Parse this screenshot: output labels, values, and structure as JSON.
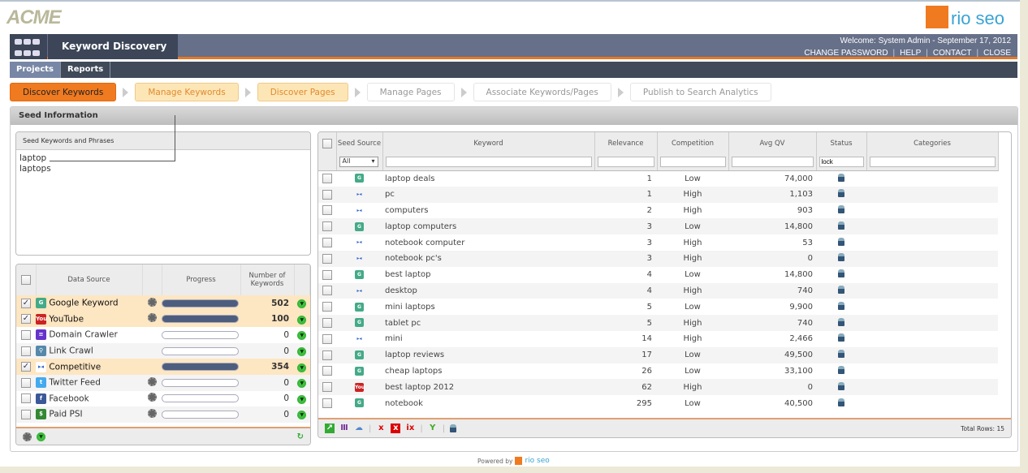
{
  "brand": {
    "client_logo": "ACME",
    "vendor_logo": "rio seo"
  },
  "header": {
    "module_title": "Keyword Discovery",
    "welcome": "Welcome: System Admin  -   September 17, 2012",
    "links": [
      "CHANGE PASSWORD",
      "HELP",
      "CONTACT",
      "CLOSE"
    ]
  },
  "subnav": [
    "Projects",
    "Reports"
  ],
  "steps": [
    {
      "label": "Discover Keywords",
      "state": "current"
    },
    {
      "label": "Manage Keywords",
      "state": "done"
    },
    {
      "label": "Discover Pages",
      "state": "done"
    },
    {
      "label": "Manage Pages",
      "state": "disabled"
    },
    {
      "label": "Associate Keywords/Pages",
      "state": "disabled"
    },
    {
      "label": "Publish to Search Analytics",
      "state": "disabled"
    }
  ],
  "panel": {
    "title": "Seed Information"
  },
  "seed": {
    "title": "Seed Keywords and Phrases",
    "lines": [
      "laptop",
      "laptops"
    ]
  },
  "sources": {
    "headers": [
      "Data Source",
      "Progress",
      "Number of Keywords"
    ],
    "rows": [
      {
        "name": "Google Keyword",
        "checked": true,
        "icon": "google-icon",
        "gear": true,
        "progress": 100,
        "count": "502"
      },
      {
        "name": "YouTube",
        "checked": true,
        "icon": "youtube-icon",
        "gear": true,
        "progress": 100,
        "count": "100"
      },
      {
        "name": "Domain Crawler",
        "checked": false,
        "icon": "domain-crawler-icon",
        "gear": false,
        "progress": 0,
        "count": "0"
      },
      {
        "name": "Link Crawl",
        "checked": false,
        "icon": "link-crawl-icon",
        "gear": false,
        "progress": 0,
        "count": "0"
      },
      {
        "name": "Competitive",
        "checked": true,
        "icon": "competitive-icon",
        "gear": false,
        "progress": 100,
        "count": "354"
      },
      {
        "name": "Twitter Feed",
        "checked": false,
        "icon": "twitter-icon",
        "gear": true,
        "progress": 0,
        "count": "0"
      },
      {
        "name": "Facebook",
        "checked": false,
        "icon": "facebook-icon",
        "gear": true,
        "progress": 0,
        "count": "0"
      },
      {
        "name": "Paid PSI",
        "checked": false,
        "icon": "paid-psi-icon",
        "gear": true,
        "progress": 0,
        "count": "0"
      }
    ]
  },
  "grid": {
    "headers": [
      "Seed Source",
      "Keyword",
      "Relevance",
      "Competition",
      "Avg QV",
      "Status",
      "Categories"
    ],
    "filters": {
      "seed_source": "All",
      "status": "lock"
    },
    "rows": [
      {
        "src": "google",
        "kw": "laptop deals",
        "rel": "1",
        "comp": "Low",
        "qv": "74,000"
      },
      {
        "src": "competitive",
        "kw": "pc",
        "rel": "1",
        "comp": "High",
        "qv": "1,103"
      },
      {
        "src": "competitive",
        "kw": "computers",
        "rel": "2",
        "comp": "High",
        "qv": "903"
      },
      {
        "src": "google",
        "kw": "laptop computers",
        "rel": "3",
        "comp": "Low",
        "qv": "14,800"
      },
      {
        "src": "competitive",
        "kw": "notebook computer",
        "rel": "3",
        "comp": "High",
        "qv": "53"
      },
      {
        "src": "competitive",
        "kw": "notebook pc's",
        "rel": "3",
        "comp": "High",
        "qv": "0"
      },
      {
        "src": "google",
        "kw": "best laptop",
        "rel": "4",
        "comp": "Low",
        "qv": "14,800"
      },
      {
        "src": "competitive",
        "kw": "desktop",
        "rel": "4",
        "comp": "High",
        "qv": "740"
      },
      {
        "src": "google",
        "kw": "mini laptops",
        "rel": "5",
        "comp": "Low",
        "qv": "9,900"
      },
      {
        "src": "google",
        "kw": "tablet pc",
        "rel": "5",
        "comp": "High",
        "qv": "740"
      },
      {
        "src": "competitive",
        "kw": "mini",
        "rel": "14",
        "comp": "High",
        "qv": "2,466"
      },
      {
        "src": "google",
        "kw": "laptop reviews",
        "rel": "17",
        "comp": "Low",
        "qv": "49,500"
      },
      {
        "src": "google",
        "kw": "cheap laptops",
        "rel": "26",
        "comp": "Low",
        "qv": "33,100"
      },
      {
        "src": "youtube",
        "kw": "best laptop 2012",
        "rel": "62",
        "comp": "High",
        "qv": "0"
      },
      {
        "src": "google",
        "kw": "notebook",
        "rel": "295",
        "comp": "Low",
        "qv": "40,500"
      }
    ],
    "total_rows": "Total Rows: 15"
  },
  "footer": {
    "powered_by": "Powered by",
    "vendor": "rio seo"
  },
  "colors": {
    "accent": "#f07a20",
    "header": "#667089",
    "selected_row": "#fde6c2"
  }
}
